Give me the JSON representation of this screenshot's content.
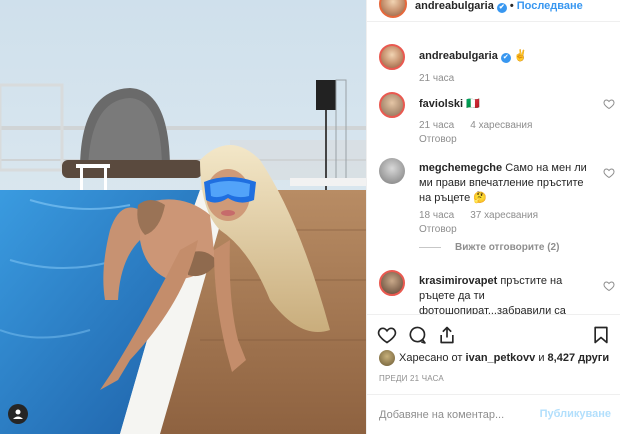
{
  "header": {
    "username": "andreabulgaria",
    "follow_label": "Последване",
    "separator": "•"
  },
  "caption": {
    "username": "andreabulgaria",
    "text": "✌",
    "time": "21 часа"
  },
  "comments": [
    {
      "username": "faviolski",
      "text": "🇮🇹",
      "time": "21 часа",
      "likes": "4 харесвания",
      "reply": "Отговор"
    },
    {
      "username": "megchemegche",
      "text": "Само на мен ли ми прави впечатление пръстите на ръцете 🤔",
      "time": "18 часа",
      "likes": "37 харесвания",
      "reply": "Отговор",
      "view_replies": "Вижте отговорите (2)"
    },
    {
      "username": "krasimirovapet",
      "text": "пръстите на ръцете да ти фотошопират...забравили са"
    }
  ],
  "likes": {
    "prefix": "Харесано от",
    "user": "ivan_petkovv",
    "connector": "и",
    "count": "8,427 други"
  },
  "time_ago": "ПРЕДИ 21 ЧАСА",
  "comment_box": {
    "placeholder": "Добавяне на коментар...",
    "post_label": "Публикуване"
  },
  "colors": {
    "accent": "#3897f0",
    "muted": "#8e8e8e",
    "post_disabled": "#b2dffc",
    "pool": "#2f8fd8"
  },
  "icons": [
    "heart-icon",
    "comment-icon",
    "share-icon",
    "bookmark-icon",
    "verified-icon",
    "user-icon"
  ]
}
